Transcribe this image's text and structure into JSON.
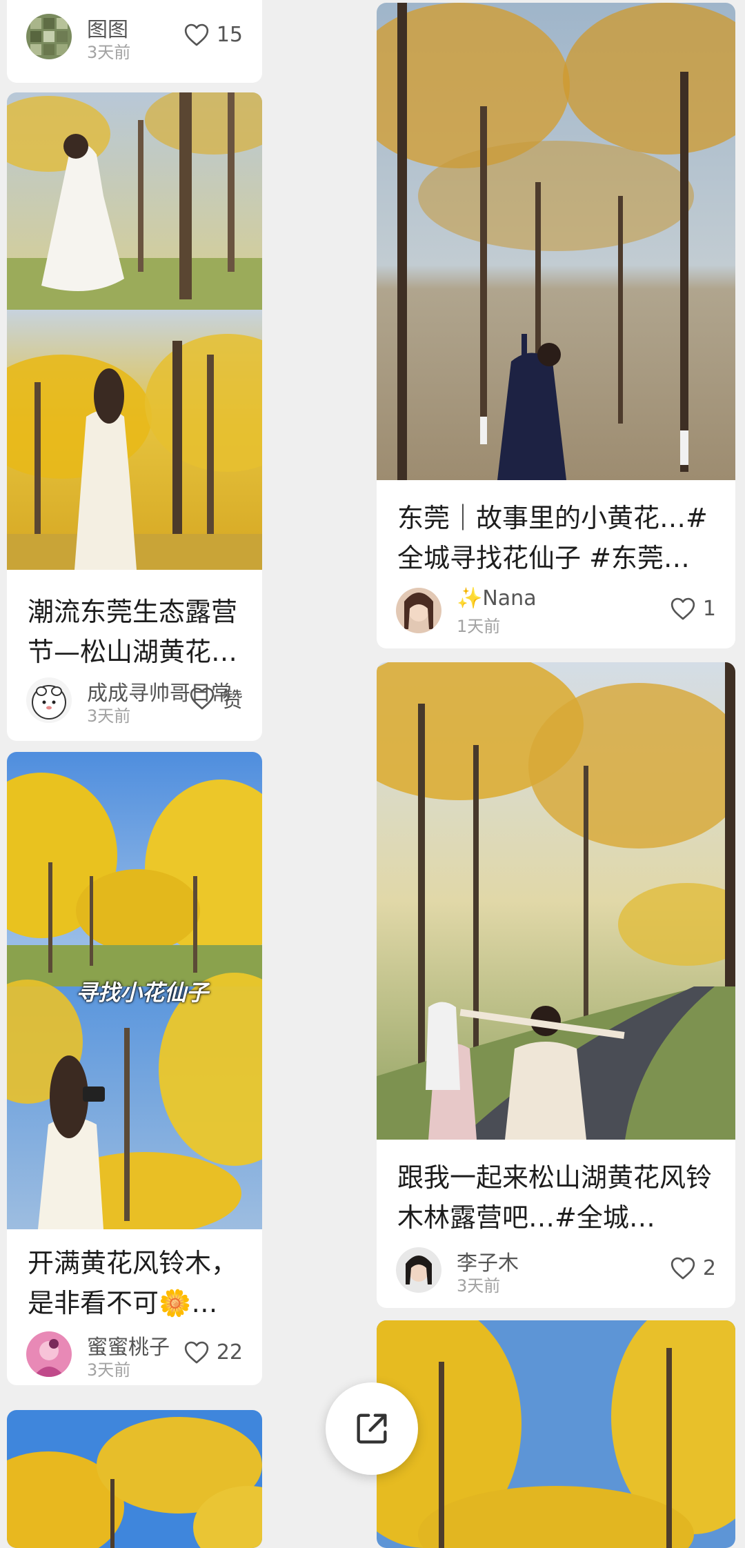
{
  "feed": {
    "cards": [
      {
        "id": "c0",
        "title": "",
        "author": "图图",
        "time": "3天前",
        "likes": "15"
      },
      {
        "id": "c1",
        "title": "潮流东莞生态露营节—松山湖黄花风铃木专场[…",
        "author": "成成寻帅哥日常",
        "time": "3天前",
        "likes": "赞"
      },
      {
        "id": "c2",
        "title": "开满黄花风铃木，是非看不可🌼…#全城寻找花…",
        "author": "蜜蜜桃子",
        "time": "3天前",
        "likes": "22",
        "photo_caption": "寻找小花仙子"
      },
      {
        "id": "c3",
        "title": "东莞｜故事里的小黄花…#全城寻找花仙子 #东莞…",
        "author": "✨Nana",
        "time": "1天前",
        "likes": "1"
      },
      {
        "id": "c4",
        "title": "跟我一起来松山湖黄花风铃木林露营吧…#全城…",
        "author": "李子木",
        "time": "3天前",
        "likes": "2"
      }
    ]
  },
  "icons": {
    "like": "heart-outline-icon",
    "share": "share-external-icon"
  },
  "colors": {
    "background": "#efefef",
    "card": "#ffffff",
    "accent_yellow": "#e9b21b",
    "sky_blue": "#5d95d6"
  }
}
